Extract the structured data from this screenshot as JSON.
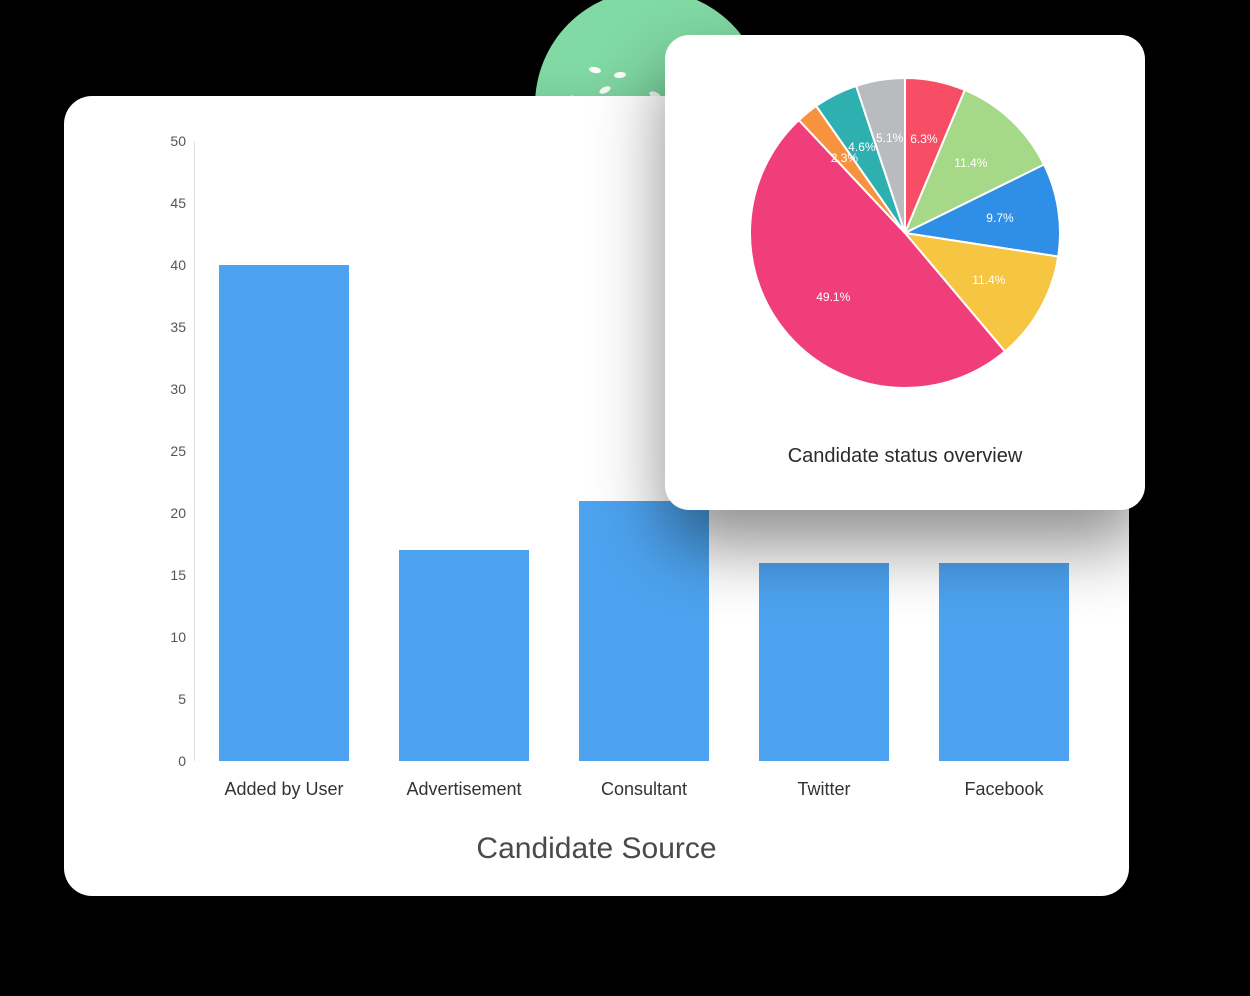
{
  "chart_data": [
    {
      "type": "bar",
      "title": "Candidate Source",
      "categories": [
        "Added by User",
        "Advertisement",
        "Consultant",
        "Twitter",
        "Facebook"
      ],
      "values": [
        40,
        17,
        21,
        16,
        16
      ],
      "ylim": [
        0,
        50
      ],
      "y_ticks": [
        0,
        5,
        10,
        15,
        20,
        25,
        30,
        35,
        40,
        45,
        50
      ],
      "bar_color": "#4da3ef"
    },
    {
      "type": "pie",
      "title": "Candidate status overview",
      "slices": [
        {
          "value": 6.3,
          "label": "6.3%",
          "color": "#f74e66"
        },
        {
          "value": 11.4,
          "label": "11.4%",
          "color": "#a6d987"
        },
        {
          "value": 9.7,
          "label": "9.7%",
          "color": "#2f8ee6"
        },
        {
          "value": 11.4,
          "label": "11.4%",
          "color": "#f6c542"
        },
        {
          "value": 49.1,
          "label": "49.1%",
          "color": "#ef3e7a"
        },
        {
          "value": 2.3,
          "label": "2.3%",
          "color": "#f7933f"
        },
        {
          "value": 4.6,
          "label": "4.6%",
          "color": "#2fb0b0"
        },
        {
          "value": 5.1,
          "label": "5.1%",
          "color": "#b8bcbf"
        }
      ]
    }
  ],
  "decor": {
    "green": "#81d9a4"
  }
}
